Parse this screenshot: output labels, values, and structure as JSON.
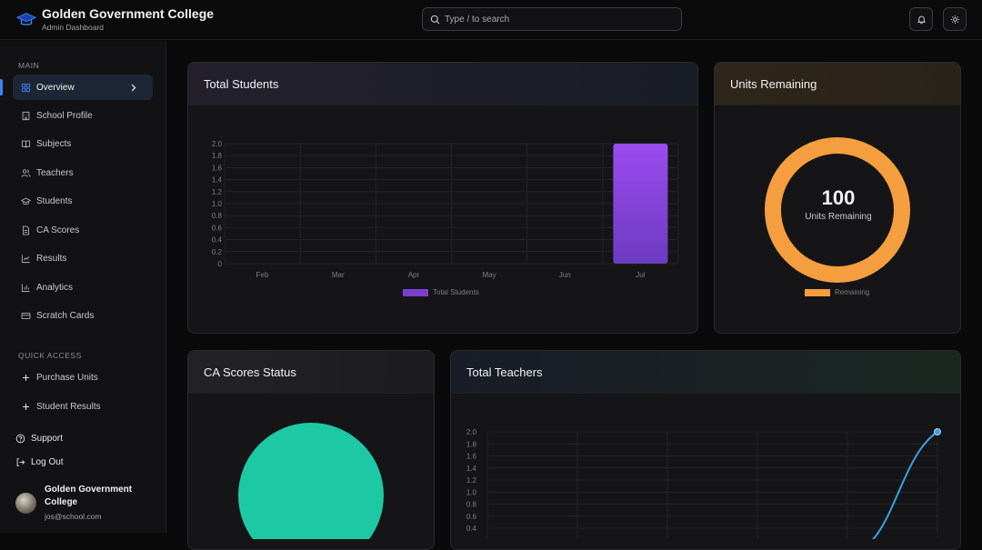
{
  "header": {
    "title": "Golden Government College",
    "subtitle": "Admin Dashboard",
    "search_placeholder": "Type / to search"
  },
  "sidebar": {
    "main_label": "MAIN",
    "items": [
      {
        "label": "Overview",
        "icon": "grid-icon",
        "active": true
      },
      {
        "label": "School Profile",
        "icon": "building-icon"
      },
      {
        "label": "Subjects",
        "icon": "book-icon"
      },
      {
        "label": "Teachers",
        "icon": "users-icon"
      },
      {
        "label": "Students",
        "icon": "graduation-cap-icon"
      },
      {
        "label": "CA Scores",
        "icon": "file-icon"
      },
      {
        "label": "Results",
        "icon": "trend-icon"
      },
      {
        "label": "Analytics",
        "icon": "bar-chart-icon"
      },
      {
        "label": "Scratch Cards",
        "icon": "card-icon"
      }
    ],
    "quick_label": "QUICK ACCESS",
    "quick": [
      {
        "label": "Purchase Units",
        "icon": "plus-icon"
      },
      {
        "label": "Student Results",
        "icon": "plus-icon"
      }
    ],
    "support": "Support",
    "logout": "Log Out",
    "user": {
      "name": "Golden Government College",
      "email": "jos@school.com"
    }
  },
  "cards": {
    "students": {
      "title": "Total Students",
      "legend": "Total Students"
    },
    "units": {
      "title": "Units Remaining",
      "value": "100",
      "caption": "Units Remaining",
      "legend": "Remaining"
    },
    "ca": {
      "title": "CA Scores Status"
    },
    "teachers": {
      "title": "Total Teachers"
    }
  },
  "colors": {
    "accent": "#3b82f6",
    "purple": "#8b45e6",
    "orange": "#f59e3f",
    "teal": "#1dc9a4",
    "line": "#3b9fe6"
  },
  "chart_data": [
    {
      "type": "bar",
      "title": "Total Students",
      "categories": [
        "Feb",
        "Mar",
        "Apr",
        "May",
        "Jun",
        "Jul"
      ],
      "series": [
        {
          "name": "Total Students",
          "values": [
            0,
            0,
            0,
            0,
            0,
            2
          ]
        }
      ],
      "yticks": [
        "0",
        "0.2",
        "0.4",
        "0.6",
        "0.8",
        "1.0",
        "1.2",
        "1.4",
        "1.6",
        "1.8",
        "2.0"
      ],
      "ylim": [
        0,
        2
      ],
      "legend": "bottom"
    },
    {
      "type": "pie",
      "title": "Units Remaining",
      "series": [
        {
          "name": "Remaining",
          "values": [
            100
          ]
        }
      ],
      "legend": "bottom"
    },
    {
      "type": "pie",
      "title": "CA Scores Status",
      "values": [
        1
      ]
    },
    {
      "type": "line",
      "title": "Total Teachers",
      "x": [
        0,
        1,
        2,
        3,
        4,
        5
      ],
      "values": [
        0,
        0,
        0,
        0,
        0,
        2
      ],
      "yticks": [
        "0.4",
        "0.6",
        "0.8",
        "1.0",
        "1.2",
        "1.4",
        "1.6",
        "1.8",
        "2.0"
      ],
      "ylim": [
        0,
        2
      ]
    }
  ]
}
